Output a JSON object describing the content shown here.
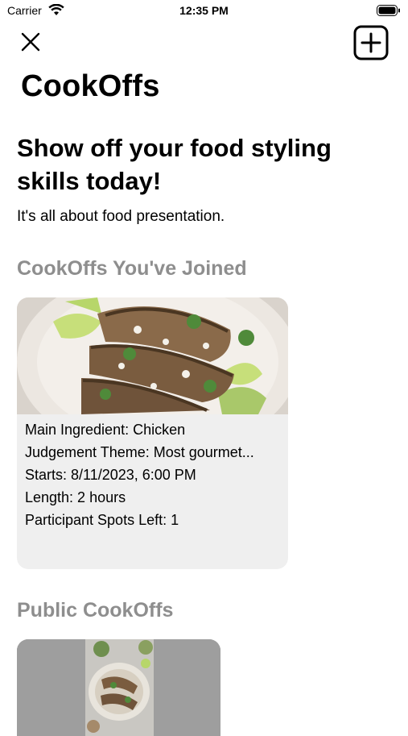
{
  "status_bar": {
    "carrier": "Carrier",
    "time": "12:35 PM"
  },
  "nav": {
    "close_icon": "close-icon",
    "add_icon": "add-square-icon"
  },
  "app": {
    "title": "CookOffs"
  },
  "hero": {
    "headline": "Show off your food styling skills today!",
    "subheadline": "It's all about food presentation."
  },
  "sections": {
    "joined_title": "CookOffs You've Joined",
    "public_title": "Public CookOffs"
  },
  "joined_cookoffs": [
    {
      "main_ingredient": "Main Ingredient: Chicken",
      "judgement_theme": "Judgement Theme: Most gourmet...",
      "starts": "Starts: 8/11/2023, 6:00 PM",
      "length": "Length: 2 hours",
      "spots_left": "Participant Spots Left: 1"
    }
  ],
  "colors": {
    "section_title": "#8e8e8e",
    "card_background": "#efefef",
    "public_card_overlay": "#9e9e9e"
  }
}
